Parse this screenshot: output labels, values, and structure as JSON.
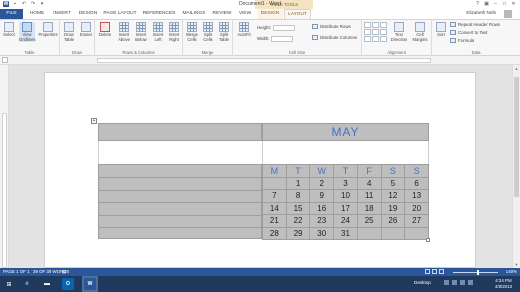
{
  "window": {
    "title": "Document1 - Word",
    "contextual_group": "TABLE TOOLS",
    "user_name": "Elizabeth Nofs"
  },
  "tabs": [
    {
      "label": "FILE"
    },
    {
      "label": "HOME"
    },
    {
      "label": "INSERT"
    },
    {
      "label": "DESIGN"
    },
    {
      "label": "PAGE LAYOUT"
    },
    {
      "label": "REFERENCES"
    },
    {
      "label": "MAILINGS"
    },
    {
      "label": "REVIEW"
    },
    {
      "label": "VIEW"
    },
    {
      "label": "DESIGN"
    },
    {
      "label": "LAYOUT"
    }
  ],
  "ribbon": {
    "groups": {
      "table": "Table",
      "draw": "Draw",
      "rows_columns": "Rows & Columns",
      "merge": "Merge",
      "cell_size": "Cell Size",
      "alignment": "Alignment",
      "data": "Data"
    },
    "buttons": {
      "select": "Select",
      "view_gridlines": "View Gridlines",
      "properties": "Properties",
      "draw_table": "Draw Table",
      "eraser": "Eraser",
      "delete": "Delete",
      "insert_above": "Insert Above",
      "insert_below": "Insert Below",
      "insert_left": "Insert Left",
      "insert_right": "Insert Right",
      "merge_cells": "Merge Cells",
      "split_cells": "Split Cells",
      "split_table": "Split Table",
      "autofit": "AutoFit",
      "text_direction": "Text Direction",
      "cell_margins": "Cell Margins",
      "sort": "Sort"
    },
    "cell_size": {
      "height_label": "Height:",
      "width_label": "Width:",
      "distribute_rows": "Distribute Rows",
      "distribute_columns": "Distribute Columns"
    },
    "data": {
      "repeat_header_rows": "Repeat Header Rows",
      "convert_to_text": "Convert to Text",
      "formula": "Formula"
    }
  },
  "document": {
    "calendar": {
      "month": "MAY",
      "weekdays": [
        "M",
        "T",
        "W",
        "T",
        "F",
        "S",
        "S"
      ],
      "weeks": [
        [
          "",
          "1",
          "2",
          "3",
          "4",
          "5",
          "6"
        ],
        [
          "7",
          "8",
          "9",
          "10",
          "11",
          "12",
          "13"
        ],
        [
          "14",
          "15",
          "16",
          "17",
          "18",
          "19",
          "20"
        ],
        [
          "21",
          "22",
          "23",
          "24",
          "25",
          "26",
          "27"
        ],
        [
          "28",
          "29",
          "30",
          "31",
          "",
          "",
          ""
        ]
      ]
    }
  },
  "statusbar": {
    "page": "PAGE 1 OF 1",
    "words": "39 OF 39 WORDS",
    "zoom": "140%",
    "zoom_level_percent": 140
  },
  "taskbar": {
    "desktop_label": "Desktop",
    "time": "4:24 PM",
    "date": "4/8/2013"
  },
  "colors": {
    "brand": "#2b579a",
    "contextual_tab": "#8a5a14",
    "calendar_accent": "#4472c4",
    "calendar_fill": "#bebebe"
  }
}
